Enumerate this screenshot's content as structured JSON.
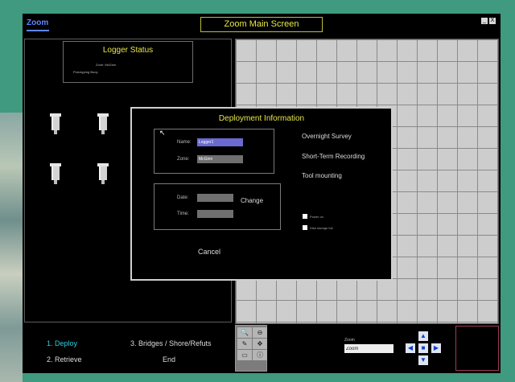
{
  "window": {
    "logo": "Zoom",
    "title": "Zoom Main Screen",
    "buttons": [
      "_",
      "X"
    ]
  },
  "logger_status": {
    "title": "Logger Status",
    "line1": "Zone: McGinn",
    "line2": "Prototyping Buoy"
  },
  "menu": {
    "item1": "1. Deploy",
    "item2": "2. Retrieve",
    "item3": "3. Bridges / Shore/Refuts",
    "item4": "End"
  },
  "toolbar": {
    "zoom_label": "Zoom",
    "zoom_value": "Zoom",
    "tools": [
      "zoom-in",
      "zoom-out",
      "pencil",
      "move",
      "eraser",
      "info"
    ]
  },
  "dialog": {
    "title": "Deployment Information",
    "group1": {
      "name_label": "Name:",
      "name_value": "Logger1",
      "zone_label": "Zone:",
      "zone_value": "McGinn"
    },
    "group2": {
      "date_label": "Date:",
      "time_label": "Time:",
      "date_value": "",
      "time_value": ""
    },
    "change_label": "Change",
    "cancel_label": "Cancel",
    "options": [
      "Overnight Survey",
      "Short-Term Recording",
      "Tool mounting"
    ],
    "checkboxes": [
      "Power on",
      "Disk storage full"
    ]
  },
  "colors": {
    "teal_background": "#3f9a7f",
    "title_yellow": "#e8e84a",
    "menu_highlight": "#2fd0e0",
    "field_blue": "#6a6ad0",
    "arrow_blue": "#1040c8"
  },
  "map": {
    "type": "grid"
  }
}
